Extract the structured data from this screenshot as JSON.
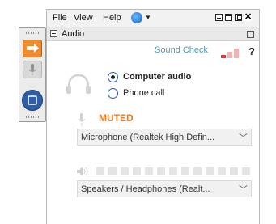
{
  "menu": {
    "file": "File",
    "view": "View",
    "help": "Help"
  },
  "audio": {
    "title": "Audio",
    "sound_check": "Sound Check",
    "help_symbol": "?",
    "options": [
      {
        "label": "Computer audio",
        "selected": true
      },
      {
        "label": "Phone call",
        "selected": false
      }
    ],
    "mic_status": "MUTED",
    "microphone_select": "Microphone (Realtek High Defin...",
    "speaker_select": "Speakers / Headphones (Realt..."
  },
  "colors": {
    "accent": "#f07a1c",
    "link": "#4a9bb0",
    "signal_red": "#e23b3b",
    "signal_pink": "#f4b1b1"
  },
  "icons": [
    "share-icon",
    "mic-icon",
    "stop-icon",
    "globe-icon",
    "headset-icon",
    "speaker-icon",
    "chevron-down-icon"
  ]
}
